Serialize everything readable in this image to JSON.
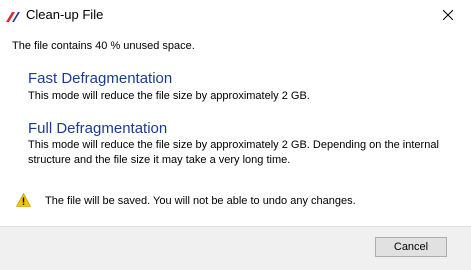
{
  "window": {
    "title": "Clean-up File",
    "app_icon": "app-logo-icon",
    "close_icon": "close-icon"
  },
  "summary": "The file contains 40 % unused space.",
  "options": {
    "fast": {
      "title": "Fast Defragmentation",
      "description": "This mode will reduce the file size by approximately 2 GB."
    },
    "full": {
      "title": "Full Defragmentation",
      "description": "This mode will reduce the file size by approximately 2 GB. Depending on the internal structure and the file size it may take a very long time."
    }
  },
  "warning": {
    "icon": "warning-icon",
    "text": "The file will be saved. You will not be able to undo any changes."
  },
  "footer": {
    "cancel_label": "Cancel"
  },
  "colors": {
    "link": "#1c3d8c",
    "footer_bg": "#f0f0f0",
    "warning_yellow": "#f5c400"
  }
}
